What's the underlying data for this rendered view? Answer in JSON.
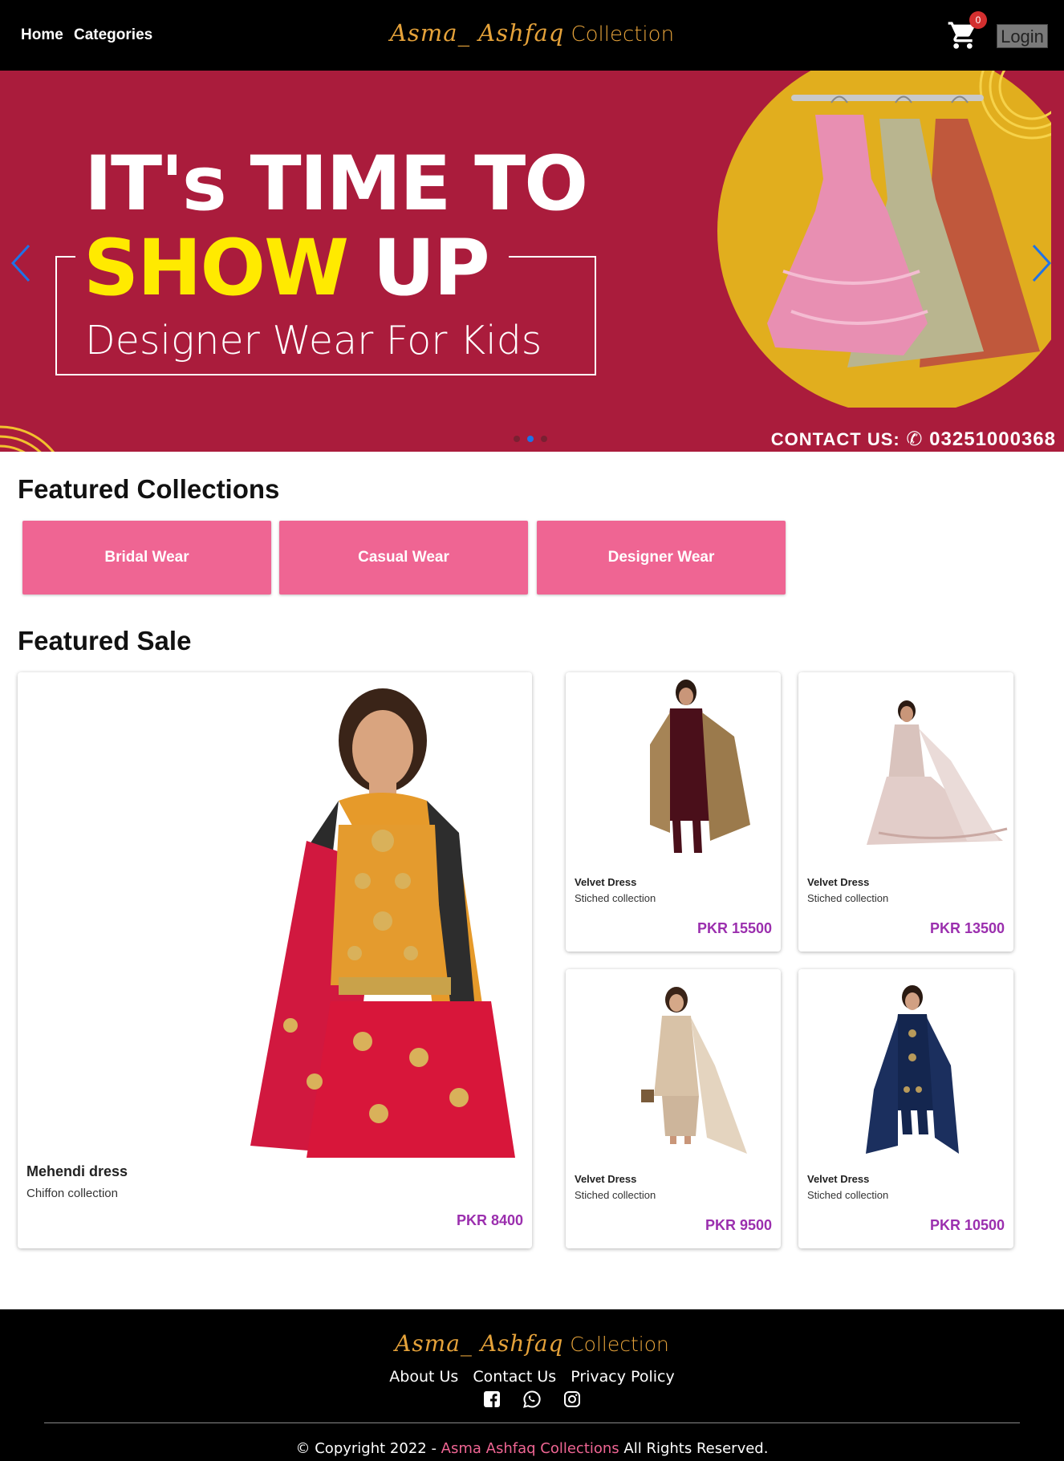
{
  "header": {
    "nav": {
      "home": "Home",
      "categories": "Categories"
    },
    "brand": {
      "script": "Asma_ Ashfaq",
      "plain": "Collection"
    },
    "cart_count": "0",
    "login_label": "Login"
  },
  "hero": {
    "line1": "IT's TIME TO",
    "line2_yellow": "SHOW",
    "line2_white": "UP",
    "line3": "Designer Wear For Kids",
    "contact_label": "CONTACT US:",
    "contact_phone": "03251000368",
    "slide_count": 3,
    "active_slide": 2,
    "colors": {
      "background": "#aa1c3c",
      "accent_yellow": "#ffea00",
      "circle": "#e1ae1e"
    }
  },
  "featured_collections": {
    "title": "Featured Collections",
    "items": [
      "Bridal Wear",
      "Casual Wear",
      "Designer Wear"
    ]
  },
  "featured_sale": {
    "title": "Featured Sale",
    "main": {
      "name": "Mehendi dress",
      "subtitle": "Chiffon collection",
      "price": "PKR 8400"
    },
    "items": [
      {
        "name": "Velvet Dress",
        "subtitle": "Stiched collection",
        "price": "PKR 15500"
      },
      {
        "name": "Velvet Dress",
        "subtitle": "Stiched collection",
        "price": "PKR 13500"
      },
      {
        "name": "Velvet Dress",
        "subtitle": "Stiched collection",
        "price": "PKR 9500"
      },
      {
        "name": "Velvet Dress",
        "subtitle": "Stiched collection",
        "price": "PKR 10500"
      }
    ]
  },
  "footer": {
    "brand": {
      "script": "Asma_ Ashfaq",
      "plain": "Collection"
    },
    "links": [
      "About Us",
      "Contact Us",
      "Privacy Policy"
    ],
    "social_icons": [
      "facebook-icon",
      "whatsapp-icon",
      "instagram-icon"
    ],
    "copyright_prefix": "© Copyright 2022 -",
    "copyright_brand": "Asma Ashfaq Collections",
    "copyright_suffix": "All Rights Reserved."
  },
  "colors": {
    "header_bg": "#000000",
    "brand_gold": "#e5a23a",
    "collection_pink": "#ef6593",
    "price_purple": "#9b2fae",
    "cart_badge_red": "#d32f2f"
  }
}
